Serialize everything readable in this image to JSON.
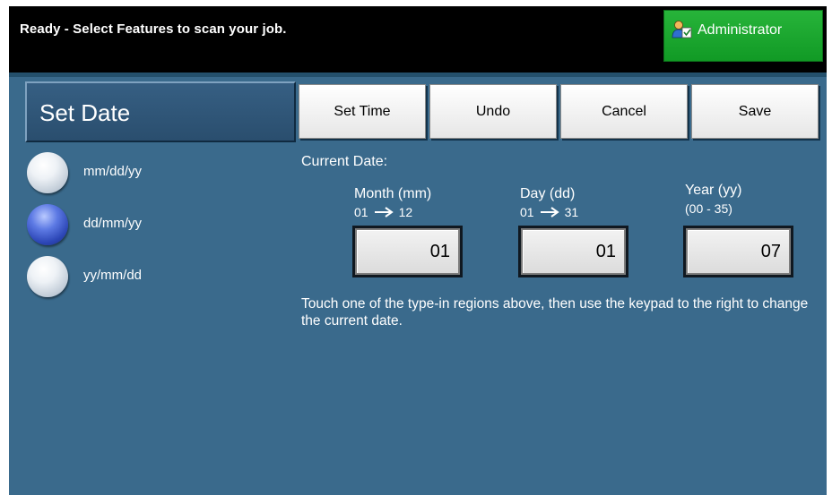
{
  "status_bar": {
    "message": "Ready - Select Features to scan your job.",
    "admin_label": "Administrator",
    "admin_icon": "administrator-user-icon"
  },
  "title": "Set Date",
  "toolbar": {
    "set_time": "Set Time",
    "undo": "Undo",
    "cancel": "Cancel",
    "save": "Save"
  },
  "formats": [
    {
      "label": "mm/dd/yy",
      "selected": false
    },
    {
      "label": "dd/mm/yy",
      "selected": true
    },
    {
      "label": "yy/mm/dd",
      "selected": false
    }
  ],
  "current_date": {
    "heading": "Current Date:",
    "month": {
      "label": "Month (mm)",
      "range_from": "01",
      "range_to": "12",
      "value": "01"
    },
    "day": {
      "label": "Day (dd)",
      "range_from": "01",
      "range_to": "31",
      "value": "01"
    },
    "year": {
      "label": "Year (yy)",
      "range": "(00 - 35)",
      "value": "07"
    }
  },
  "help_text": "Touch one of the type-in regions above, then use the keypad to the right to change the current date.",
  "colors": {
    "panel_bg": "#3a6a8c",
    "status_bg": "#000000",
    "admin_green": "#1ba830",
    "radio_selected": "#2c46b6"
  }
}
